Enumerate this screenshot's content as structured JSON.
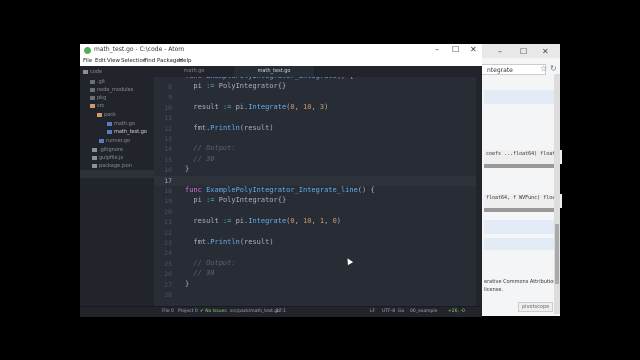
{
  "window": {
    "title": "math_test.go - C:\\code - Atom",
    "minimize": "–",
    "maximize": "☐",
    "close": "✕"
  },
  "menu": [
    "File",
    "Edit",
    "View",
    "Selection",
    "Find",
    "Packages",
    "Help"
  ],
  "tree": {
    "root": "code",
    "items": [
      ".git",
      "node_modules",
      "pkg",
      "src",
      "pack",
      "math.go",
      "math_test.go",
      "runner.go",
      ".gitignore",
      "gulpfile.js",
      "package.json"
    ],
    "selected": "math_test.go"
  },
  "tabs": [
    "math.go",
    "math_test.go"
  ],
  "editor": {
    "partial_line": "func ExamplePolyIntegrator_Integrate() {",
    "lines": [
      {
        "n": "8",
        "code": "  pi := PolyIntegrator{}"
      },
      {
        "n": "9",
        "code": ""
      },
      {
        "n": "10",
        "code": "  result := pi.Integrate(0, 10, 3)"
      },
      {
        "n": "11",
        "code": ""
      },
      {
        "n": "12",
        "code": "  fmt.Println(result)"
      },
      {
        "n": "13",
        "code": ""
      },
      {
        "n": "14",
        "code": "  // Output:"
      },
      {
        "n": "15",
        "code": "  // 30"
      },
      {
        "n": "16",
        "code": "}"
      },
      {
        "n": "17",
        "code": ""
      },
      {
        "n": "18",
        "code": "func ExamplePolyIntegrator_Integrate_line() {"
      },
      {
        "n": "19",
        "code": "  pi := PolyIntegrator{}"
      },
      {
        "n": "20",
        "code": ""
      },
      {
        "n": "21",
        "code": "  result := pi.Integrate(0, 10, 1, 0)"
      },
      {
        "n": "22",
        "code": ""
      },
      {
        "n": "23",
        "code": "  fmt.Println(result)"
      },
      {
        "n": "24",
        "code": ""
      },
      {
        "n": "25",
        "code": "  // Output:"
      },
      {
        "n": "26",
        "code": "  // 30"
      },
      {
        "n": "27",
        "code": "}"
      },
      {
        "n": "28",
        "code": ""
      }
    ]
  },
  "status": {
    "file": "File 0",
    "project": "Project 0",
    "issues": "✔ No Issues",
    "path": "src/pack/math_test.go",
    "position": "17:1",
    "line_ending": "LF",
    "encoding": "UTF-8",
    "grammar": "Go",
    "branch": "06_example",
    "diff": "+26, -0"
  },
  "browser": {
    "address": "ntegrate",
    "code1": "coefs ...float64) float",
    "code2": "float64, f WVFunc) float",
    "license": "erative Commons Attribution\nlicense.",
    "badge": "pivotscope"
  },
  "colors": {
    "editor_bg": "#282c34",
    "panel_bg": "#21252b",
    "keyword": "#c678dd",
    "function": "#61afef",
    "number": "#d19a66",
    "comment": "#5c6370"
  }
}
